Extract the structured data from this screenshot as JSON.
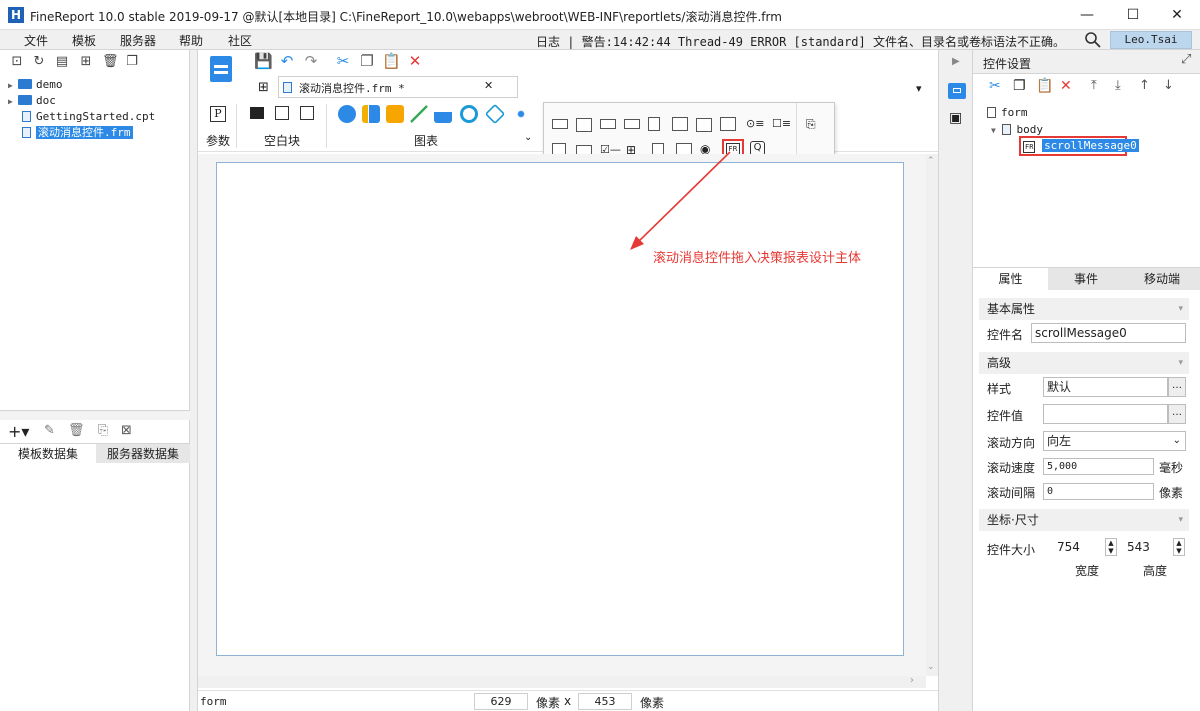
{
  "window": {
    "title": "FineReport 10.0 stable 2019-09-17 @默认[本地目录]   C:\\FineReport_10.0\\webapps\\webroot\\WEB-INF\\reportlets/滚动消息控件.frm",
    "logo": "H",
    "min": "—",
    "max": "☐",
    "close": "✕"
  },
  "menu": {
    "items": [
      "文件",
      "模板",
      "服务器",
      "帮助",
      "社区"
    ],
    "log": "日志 | 警告:14:42:44 Thread-49 ERROR [standard] 文件名、目录名或卷标语法不正确。",
    "user": "Leo.Tsai"
  },
  "tree": {
    "items": [
      {
        "label": "demo",
        "type": "folder"
      },
      {
        "label": "doc",
        "type": "folder"
      },
      {
        "label": "GettingStarted.cpt",
        "type": "file"
      },
      {
        "label": "滚动消息控件.frm",
        "type": "file"
      }
    ]
  },
  "dataset": {
    "tabs": [
      "模板数据集",
      "服务器数据集"
    ]
  },
  "doc_tab": {
    "label": "滚动消息控件.frm *",
    "close": "✕"
  },
  "ribbon": {
    "groups": [
      "参数",
      "空白块",
      "图表"
    ]
  },
  "annotation": {
    "text": "滚动消息控件拖入决策报表设计主体",
    "color": "#e53935"
  },
  "status": {
    "label": "form",
    "width": "629",
    "unit1": "像素",
    "x": "x",
    "height": "453",
    "unit2": "像素"
  },
  "right_panel": {
    "title": "控件设置",
    "widget_tree": [
      "form",
      "body",
      "scrollMessage0"
    ],
    "tabs": [
      "属性",
      "事件",
      "移动端"
    ],
    "section_basic": "基本属性",
    "name_label": "控件名",
    "name_value": "scrollMessage0",
    "section_advanced": "高级",
    "style_label": "样式",
    "style_value": "默认",
    "value_label": "控件值",
    "value_value": "",
    "direction_label": "滚动方向",
    "direction_value": "向左",
    "speed_label": "滚动速度",
    "speed_value": "5,000",
    "speed_unit": "毫秒",
    "interval_label": "滚动间隔",
    "interval_value": "0",
    "interval_unit": "像素",
    "section_coord": "坐标·尺寸",
    "size_label": "控件大小",
    "width_value": "754",
    "height_value": "543",
    "width_caption": "宽度",
    "height_caption": "高度"
  },
  "colors": {
    "accent": "#2c8ae6",
    "highlight_border": "#e53935"
  }
}
